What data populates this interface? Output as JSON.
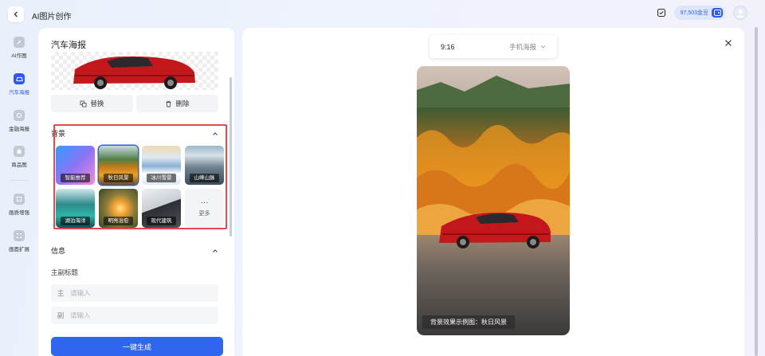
{
  "header": {
    "title": "AI图片创作",
    "coins": "97,503金豆"
  },
  "nav": {
    "items": [
      {
        "label": "AI作图",
        "icon": "ai-draw-icon"
      },
      {
        "label": "汽车海报",
        "icon": "car-icon",
        "active": true
      },
      {
        "label": "金融海报",
        "icon": "finance-icon"
      },
      {
        "label": "商品图",
        "icon": "bag-icon"
      },
      {
        "label": "画质增强",
        "icon": "enhance-icon"
      },
      {
        "label": "画面扩展",
        "icon": "expand-icon"
      }
    ]
  },
  "left": {
    "title": "汽车海报",
    "replace_label": "替换",
    "delete_label": "删除",
    "background_title": "背景",
    "backgrounds": [
      {
        "label": "智能推荐"
      },
      {
        "label": "秋日风景",
        "selected": true
      },
      {
        "label": "冰川雪景"
      },
      {
        "label": "山峰山脉"
      },
      {
        "label": "湖泊海洋"
      },
      {
        "label": "明亮治愈"
      },
      {
        "label": "现代建筑"
      }
    ],
    "more_label": "更多",
    "more_glyph": "···",
    "info_title": "信息",
    "title_field_label": "主副标题",
    "main_prefix": "主",
    "sub_prefix": "副",
    "main_placeholder": "请输入",
    "sub_placeholder": "请输入",
    "generate_label": "一键生成"
  },
  "preview": {
    "ratio": "9:16",
    "type": "手机海报",
    "caption": "背景效果示例图：秋日风景"
  },
  "colors": {
    "accent": "#2f66f0",
    "highlight": "#e8474c"
  }
}
